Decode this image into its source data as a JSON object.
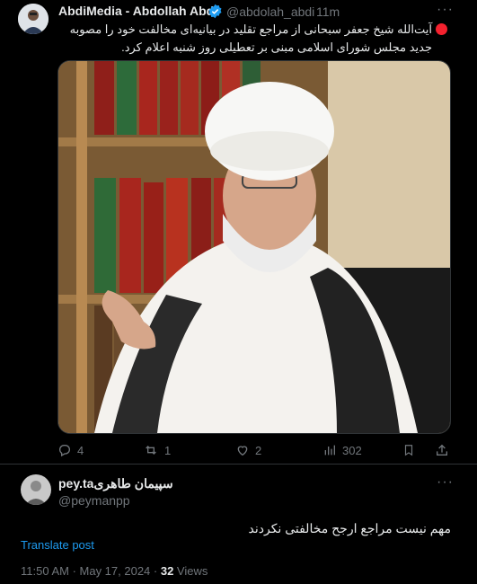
{
  "post": {
    "author_name": "AbdiMedia - Abdollah Abdi",
    "handle": "@abdolah_abdi",
    "time_sep": "·",
    "time": "11m",
    "more": "···",
    "text": "آیت‌الله شیخ جعفر سبحانی از مراجع تقلید در بیانیه‌ای مخالفت خود را مصوبه جدید مجلس شورای اسلامی مبنی بر تعطیلی روز شنبه اعلام کرد.",
    "actions": {
      "replies": "4",
      "reposts": "1",
      "likes": "2",
      "views": "302"
    }
  },
  "reply": {
    "author_name": "pey.taسپیمان طاهری",
    "handle": "@peymanpp",
    "more": "···",
    "text": "مهم نیست مراجع ارجح مخالفتی نکردند",
    "translate": "Translate post",
    "timestamp": "11:50 AM · May 17, 2024 · ",
    "views_count": "32",
    "views_label": " Views"
  },
  "colors": {
    "background": "#000000",
    "text": "#e7e9ea",
    "muted": "#71767b",
    "accent": "#1d9bf0",
    "live_dot": "#f4212e"
  }
}
